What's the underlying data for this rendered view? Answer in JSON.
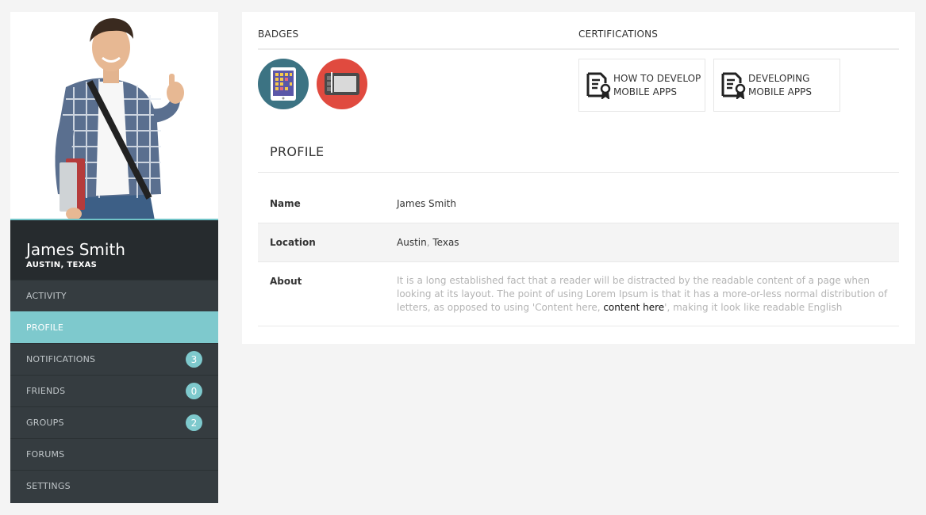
{
  "user": {
    "name": "James Smith",
    "location": "AUSTIN, TEXAS"
  },
  "sidebar": {
    "items": [
      {
        "label": "ACTIVITY",
        "count": null,
        "active": false
      },
      {
        "label": "PROFILE",
        "count": null,
        "active": true
      },
      {
        "label": "NOTIFICATIONS",
        "count": "3",
        "active": false
      },
      {
        "label": "FRIENDS",
        "count": "0",
        "active": false
      },
      {
        "label": "GROUPS",
        "count": "2",
        "active": false
      },
      {
        "label": "FORUMS",
        "count": null,
        "active": false
      },
      {
        "label": "SETTINGS",
        "count": null,
        "active": false
      }
    ]
  },
  "badges": {
    "title": "BADGES",
    "items": [
      {
        "icon": "tablet-icon",
        "color": "#3c7383"
      },
      {
        "icon": "graphics-tablet-icon",
        "color": "#e04a3f"
      }
    ]
  },
  "certifications": {
    "title": "CERTIFICATIONS",
    "items": [
      {
        "line1": "HOW TO DEVELOP",
        "line2": "MOBILE APPS",
        "icon": "certificate-icon"
      },
      {
        "line1": "DEVELOPING",
        "line2": "MOBILE APPS",
        "icon": "certificate-icon"
      }
    ]
  },
  "profile": {
    "title": "PROFILE",
    "name_label": "Name",
    "name_value": "James Smith",
    "location_label": "Location",
    "location_city": "Austin",
    "location_sep": ",",
    "location_state": "Texas",
    "about_label": "About",
    "about_text_1": "It is a long established fact that a reader will be distracted by the readable content of a page when looking at its layout. The point of using Lorem Ipsum is that it has a more-or-less normal distribution of letters, as opposed to using 'Content here, ",
    "about_link": "content here",
    "about_text_2": "', making it look like readable English"
  },
  "colors": {
    "accent": "#7ec9cd",
    "sidebar_bg": "#353c40",
    "user_box_bg": "#262b2e",
    "badge_teal": "#3c7383",
    "badge_red": "#e04a3f"
  }
}
